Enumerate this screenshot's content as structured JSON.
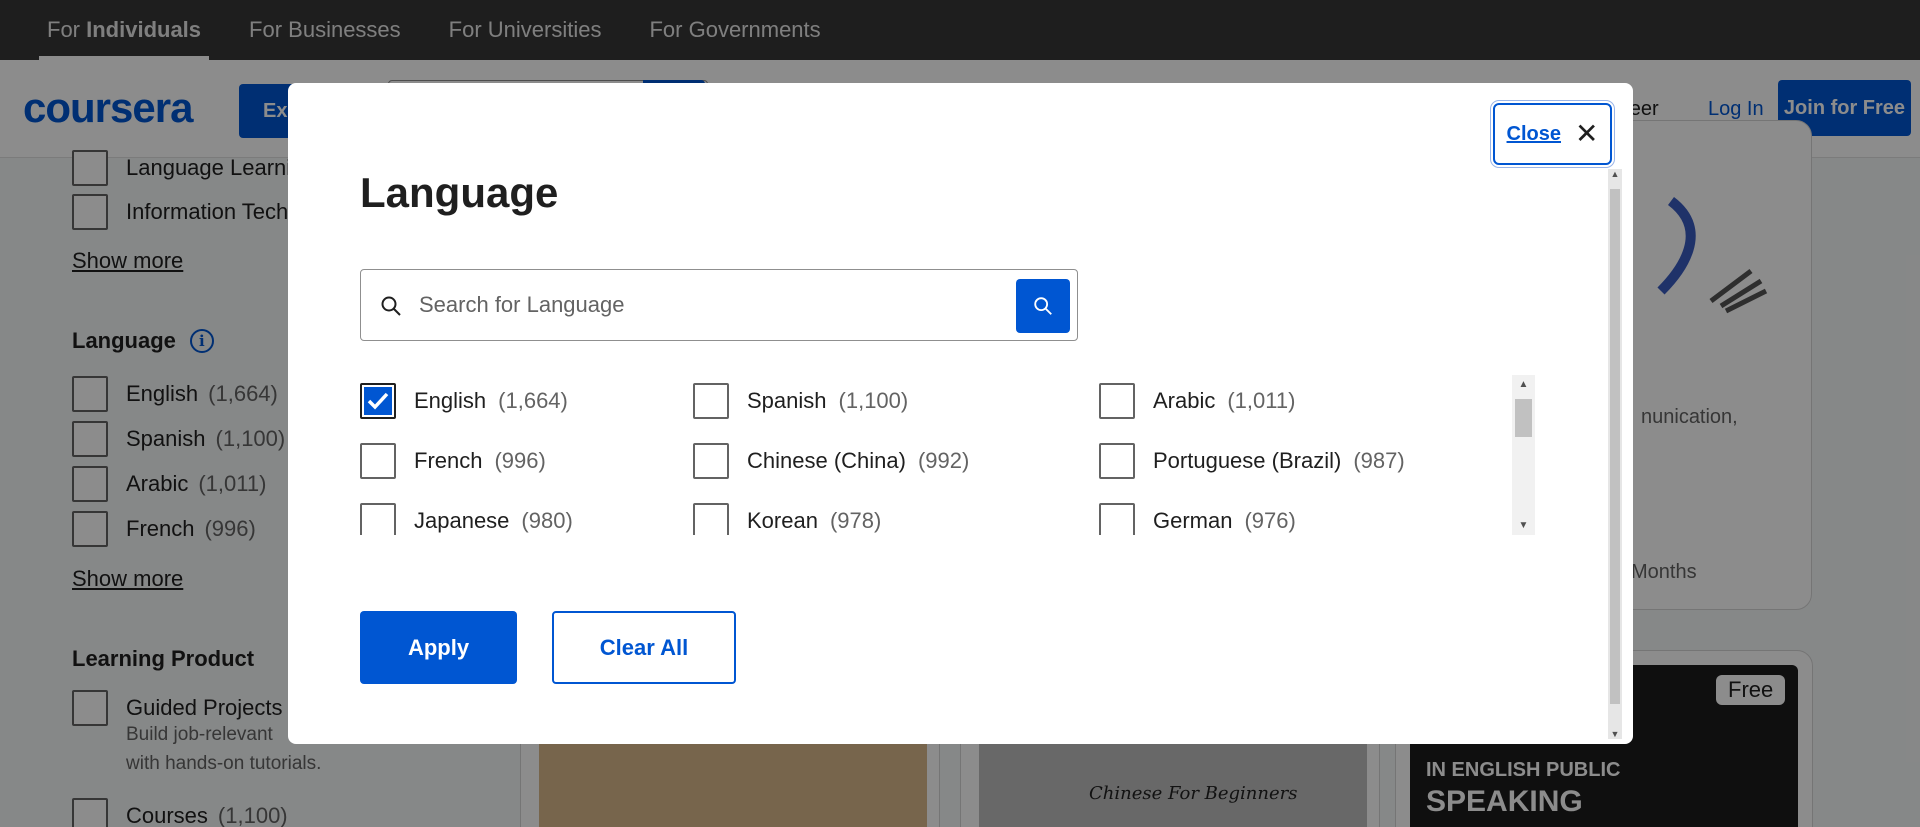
{
  "topbar": {
    "segments": [
      {
        "prefix": "For ",
        "bold": "Individuals"
      },
      {
        "label": "For Businesses"
      },
      {
        "label": "For Universities"
      },
      {
        "label": "For Governments"
      }
    ]
  },
  "header": {
    "logo": "coursera",
    "explore_label": "Ex",
    "career_label": "areer",
    "login_label": "Log In",
    "join_label": "Join for Free"
  },
  "sidebar": {
    "subject_items": [
      {
        "label": "Language Learni"
      },
      {
        "label": "Information Tech"
      }
    ],
    "subject_show_more": "Show more",
    "language_heading": "Language",
    "language_items": [
      {
        "label": "English",
        "count": "(1,664)"
      },
      {
        "label": "Spanish",
        "count": "(1,100)"
      },
      {
        "label": "Arabic",
        "count": "(1,011)"
      },
      {
        "label": "French",
        "count": "(996)"
      }
    ],
    "language_show_more": "Show more",
    "product_heading": "Learning Product",
    "product_items": [
      {
        "label": "Guided Projects",
        "desc_1": "Build job-relevant",
        "desc_2": "with hands-on tutorials."
      },
      {
        "label": "Courses",
        "count": "(1,100)"
      }
    ]
  },
  "cards": {
    "snippet_1": "nunication,",
    "snippet_2": "Months",
    "free_badge": "Free",
    "thumb_line_1": "IN ENGLISH PUBLIC",
    "thumb_line_2": "SPEAKING",
    "thumb_chinese": "Chinese For Beginners"
  },
  "modal": {
    "title": "Language",
    "close_label": "Close",
    "search_placeholder": "Search for Language",
    "options": [
      {
        "label": "English",
        "count": "(1,664)",
        "checked": true
      },
      {
        "label": "Spanish",
        "count": "(1,100)",
        "checked": false
      },
      {
        "label": "Arabic",
        "count": "(1,011)",
        "checked": false
      },
      {
        "label": "French",
        "count": "(996)",
        "checked": false
      },
      {
        "label": "Chinese (China)",
        "count": "(992)",
        "checked": false
      },
      {
        "label": "Portuguese (Brazil)",
        "count": "(987)",
        "checked": false
      },
      {
        "label": "Japanese",
        "count": "(980)",
        "checked": false
      },
      {
        "label": "Korean",
        "count": "(978)",
        "checked": false
      },
      {
        "label": "German",
        "count": "(976)",
        "checked": false
      }
    ],
    "apply_label": "Apply",
    "clear_label": "Clear All"
  },
  "colors": {
    "brand": "#0056d2",
    "topbar": "#383838",
    "overlay": "rgba(0,0,0,0.45)"
  }
}
